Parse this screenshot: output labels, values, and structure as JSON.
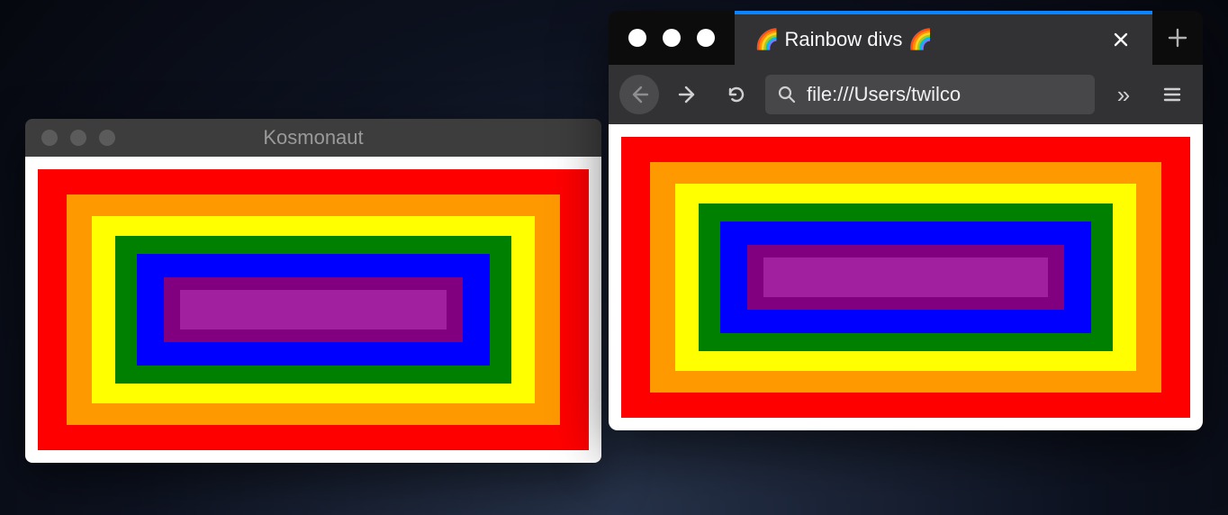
{
  "kosmonaut": {
    "title": "Kosmonaut"
  },
  "firefox": {
    "tab_title": "🌈 Rainbow divs 🌈",
    "url": "file:///Users/twilco",
    "overflow_glyph": "»"
  },
  "rainbow_colors": [
    "#ff0000",
    "#ff9900",
    "#ffff00",
    "#008000",
    "#0000ff",
    "#800080",
    "#a020a0"
  ]
}
